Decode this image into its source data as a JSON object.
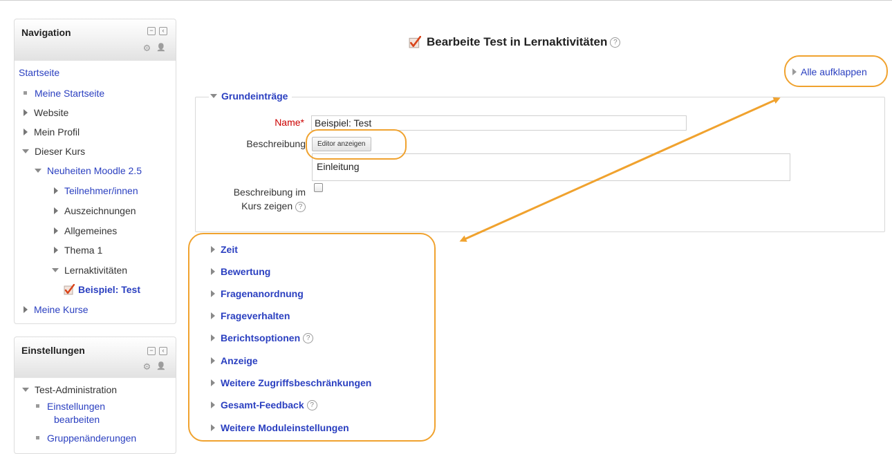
{
  "navigation": {
    "title": "Navigation",
    "items": [
      {
        "label": "Startseite"
      },
      {
        "label": "Meine Startseite"
      },
      {
        "label": "Website"
      },
      {
        "label": "Mein Profil"
      },
      {
        "label": "Dieser Kurs"
      },
      {
        "label": "Neuheiten Moodle 2.5"
      },
      {
        "label": "Teilnehmer/innen"
      },
      {
        "label": "Auszeichnungen"
      },
      {
        "label": "Allgemeines"
      },
      {
        "label": "Thema 1"
      },
      {
        "label": "Lernaktivitäten"
      },
      {
        "label": "Beispiel: Test"
      },
      {
        "label": "Meine Kurse"
      }
    ]
  },
  "settings": {
    "title": "Einstellungen",
    "items": [
      {
        "label": "Test-Administration"
      },
      {
        "label": "Einstellungen"
      },
      {
        "label": "bearbeiten"
      },
      {
        "label": "Gruppenänderungen"
      }
    ]
  },
  "main": {
    "page_title": "Bearbeite Test in Lernaktivitäten",
    "expand_all": "Alle aufklappen",
    "general": {
      "legend": "Grundeinträge",
      "name_label": "Name",
      "required_marker": "*",
      "name_value": "Beispiel: Test",
      "description_label": "Beschreibung",
      "editor_button": "Editor anzeigen",
      "description_value": "Einleitung",
      "show_desc_label_1": "Beschreibung im",
      "show_desc_label_2": "Kurs zeigen",
      "show_desc_checked": false
    },
    "sections": [
      {
        "label": "Zeit",
        "help": false
      },
      {
        "label": "Bewertung",
        "help": false
      },
      {
        "label": "Fragenanordnung",
        "help": false
      },
      {
        "label": "Frageverhalten",
        "help": false
      },
      {
        "label": "Berichtsoptionen",
        "help": true
      },
      {
        "label": "Anzeige",
        "help": false
      },
      {
        "label": "Weitere Zugriffsbeschränkungen",
        "help": false
      },
      {
        "label": "Gesamt-Feedback",
        "help": true
      },
      {
        "label": "Weitere Moduleinstellungen",
        "help": false
      }
    ]
  },
  "icons": {
    "help": "?",
    "collapse": "−",
    "dock": "‹",
    "gear": "⚙",
    "add_user": "👤"
  },
  "colors": {
    "link": "#2a3fc0",
    "annotation": "#f0a22e",
    "required": "#cc0000"
  }
}
